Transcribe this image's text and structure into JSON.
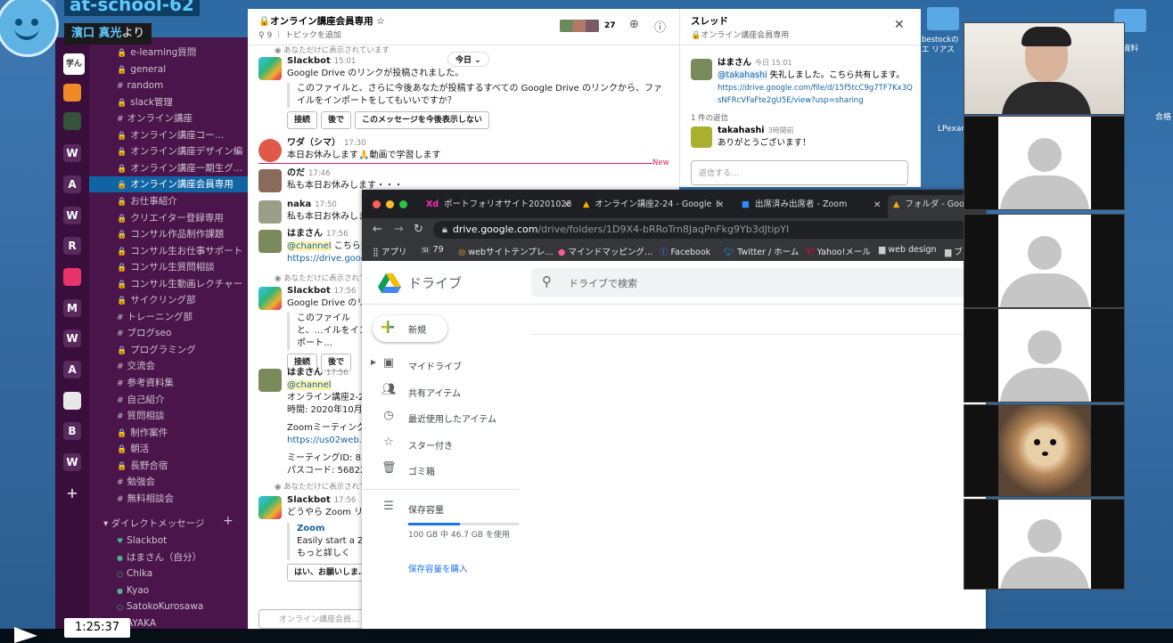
{
  "overlay": {
    "meeting_name": "at-school-62",
    "speaker_name": "濱口 真光",
    "speaker_suffix": "より",
    "timestamp": "1:25:37"
  },
  "desktop": {
    "files": [
      "bestockのエ リアス",
      "資料",
      "LPexample.",
      "合格"
    ]
  },
  "slack": {
    "workspace_icons": [
      "学ん",
      "",
      "",
      "",
      "W",
      "A",
      "W",
      "R",
      "",
      "M",
      "W",
      "A",
      "",
      "B",
      "W",
      "+"
    ],
    "channels": [
      {
        "prefix": "🔒",
        "name": "e-learning質問"
      },
      {
        "prefix": "🔒",
        "name": "general"
      },
      {
        "prefix": "#",
        "name": "random"
      },
      {
        "prefix": "🔒",
        "name": "slack管理"
      },
      {
        "prefix": "#",
        "name": "オンライン講座"
      },
      {
        "prefix": "🔒",
        "name": "オンライン講座コー…"
      },
      {
        "prefix": "🔒",
        "name": "オンライン講座デザイン編"
      },
      {
        "prefix": "🔒",
        "name": "オンライン講座一期生グ…"
      },
      {
        "prefix": "🔒",
        "name": "オンライン講座会員専用",
        "active": true
      },
      {
        "prefix": "🔒",
        "name": "お仕事紹介"
      },
      {
        "prefix": "🔒",
        "name": "クリエイター登録専用"
      },
      {
        "prefix": "🔒",
        "name": "コンサル作品制作課題"
      },
      {
        "prefix": "🔒",
        "name": "コンサル生お仕事サポート"
      },
      {
        "prefix": "🔒",
        "name": "コンサル生質問相談"
      },
      {
        "prefix": "🔒",
        "name": "コンサル生動画レクチャー"
      },
      {
        "prefix": "🔒",
        "name": "サイクリング部"
      },
      {
        "prefix": "#",
        "name": "トレーニング部"
      },
      {
        "prefix": "#",
        "name": "ブログseo"
      },
      {
        "prefix": "🔒",
        "name": "プログラミング"
      },
      {
        "prefix": "#",
        "name": "交流会"
      },
      {
        "prefix": "#",
        "name": "参考資料集"
      },
      {
        "prefix": "#",
        "name": "自己紹介"
      },
      {
        "prefix": "#",
        "name": "質問相談"
      },
      {
        "prefix": "🔒",
        "name": "制作案件"
      },
      {
        "prefix": "🔒",
        "name": "朝活"
      },
      {
        "prefix": "🔒",
        "name": "長野合宿"
      },
      {
        "prefix": "#",
        "name": "勉強会"
      },
      {
        "prefix": "#",
        "name": "無料相談会"
      }
    ],
    "dm_header": "ダイレクトメッセージ",
    "dms": [
      {
        "status": "♥",
        "name": "Slackbot"
      },
      {
        "status": "●",
        "name": "はまさん（自分）"
      },
      {
        "status": "○",
        "name": "Chika"
      },
      {
        "status": "●",
        "name": "Kyao"
      },
      {
        "status": "○",
        "name": "SatokoKurosawa"
      },
      {
        "status": "○",
        "name": "AYAKA"
      }
    ],
    "channel_header": {
      "title": "🔒オンライン講座会員専用",
      "star": "☆",
      "sub": "♀ 9 ｜ トピックを追加",
      "member_count": "27"
    },
    "date_divider": "今日 ⌄",
    "only_visible_to_you": "あなただけに表示されています",
    "new_label": "New",
    "messages": {
      "m1": {
        "name": "Slackbot",
        "time": "15:01",
        "text": "Google Drive のリンクが投稿されました。",
        "quote": "このファイルと、さらに今後あなたが投稿するすべての Google Drive のリンクから、ファイルをインポートをしてもいいですか？",
        "b1": "接続",
        "b2": "後で",
        "b3": "このメッセージを今後表示しない"
      },
      "m2": {
        "name": "ワダ（シマ）",
        "time": "17:30",
        "text": "本日お休みします🙏動画で学習します"
      },
      "m3": {
        "name": "のだ",
        "time": "17:46",
        "text": "私も本日お休みします・・・"
      },
      "m4": {
        "name": "naka",
        "time": "17:50",
        "text": "私も本日お休みします。"
      },
      "m5": {
        "name": "はまさん",
        "time": "17:56",
        "mention": "@channel",
        "text": " こちら素…",
        "link": "https://drive.google…"
      },
      "m6": {
        "name": "Slackbot",
        "time": "17:56",
        "text": "Google Drive のリン…",
        "quote": "このファイルと、…イルをインポート…",
        "b1": "接続",
        "b2": "後で"
      },
      "m7": {
        "name": "はまさん",
        "time": "17:56",
        "mention": "@channel",
        "l1": "オンライン講座2-24…",
        "l2": "時間: 2020年10月31…",
        "l3": "Zoomミーティングに…",
        "link": "https://us02web.zoom…",
        "l4": "ミーティングID: 853…",
        "l5": "パスコード: 568223…"
      },
      "m8": {
        "name": "Slackbot",
        "time": "17:56",
        "text": "どうやら Zoom リン…か？",
        "app": "Zoom",
        "app_text": "Easily start a Zoom…",
        "app_more": "もっと詳しく",
        "b1": "はい、お願いしま…"
      }
    },
    "composer_placeholder": "オンライン講座会員…",
    "thread": {
      "title": "スレッド",
      "sub": "🔒オンライン講座会員専用",
      "parent_name": "はまさん",
      "parent_time": "今日 15:01",
      "parent_mention": "@takahashi",
      "parent_text": " 失礼しました。こちら共有します。",
      "parent_link": "https://drive.google.com/file/d/15f5tcC9g7TF7Kx3QsNFRcVFaFte2gU5E/view?usp=sharing",
      "reply_count": "1 件の返信",
      "reply_name": "takahashi",
      "reply_time": "3時間前",
      "reply_text": "ありがとうございます！",
      "input_placeholder": "返信する…"
    }
  },
  "chrome": {
    "tabs": [
      {
        "icon": "Xd",
        "label": "ポートフォリオサイト20201028"
      },
      {
        "icon": "▲",
        "label": "オンライン講座2-24 - Google ドライブ"
      },
      {
        "icon": "■",
        "label": "出席済み出席者 - Zoom"
      },
      {
        "icon": "▲",
        "label": "フォルダ - Goo"
      }
    ],
    "url_host": "drive.google.com",
    "url_path": "/drive/folders/1D9X4-bRRoTrn8JaqPnFkg9Yb3dJtipYI",
    "bookmarks": [
      "アプリ",
      "79",
      "webサイトテンプレ…",
      "マインドマッピング…",
      "Facebook",
      "Twitter / ホーム",
      "Yahoo!メール",
      "web design",
      "ブログ制作"
    ]
  },
  "drive": {
    "logo_text": "ドライブ",
    "search_placeholder": "ドライブで検索",
    "new_label": "新規",
    "nav": [
      "マイドライブ",
      "共有アイテム",
      "最近使用したアイテム",
      "スター付き",
      "ゴミ箱"
    ],
    "storage_label": "保存容量",
    "storage_usage": "100 GB 中 46.7 GB を使用",
    "storage_fraction": 0.467,
    "buy_storage": "保存容量を購入"
  },
  "colors": {
    "slack_sidebar": "#4a154b",
    "slack_active": "#1164a3",
    "drive_blue": "#1a73e8",
    "new_red": "#e01e5a"
  }
}
